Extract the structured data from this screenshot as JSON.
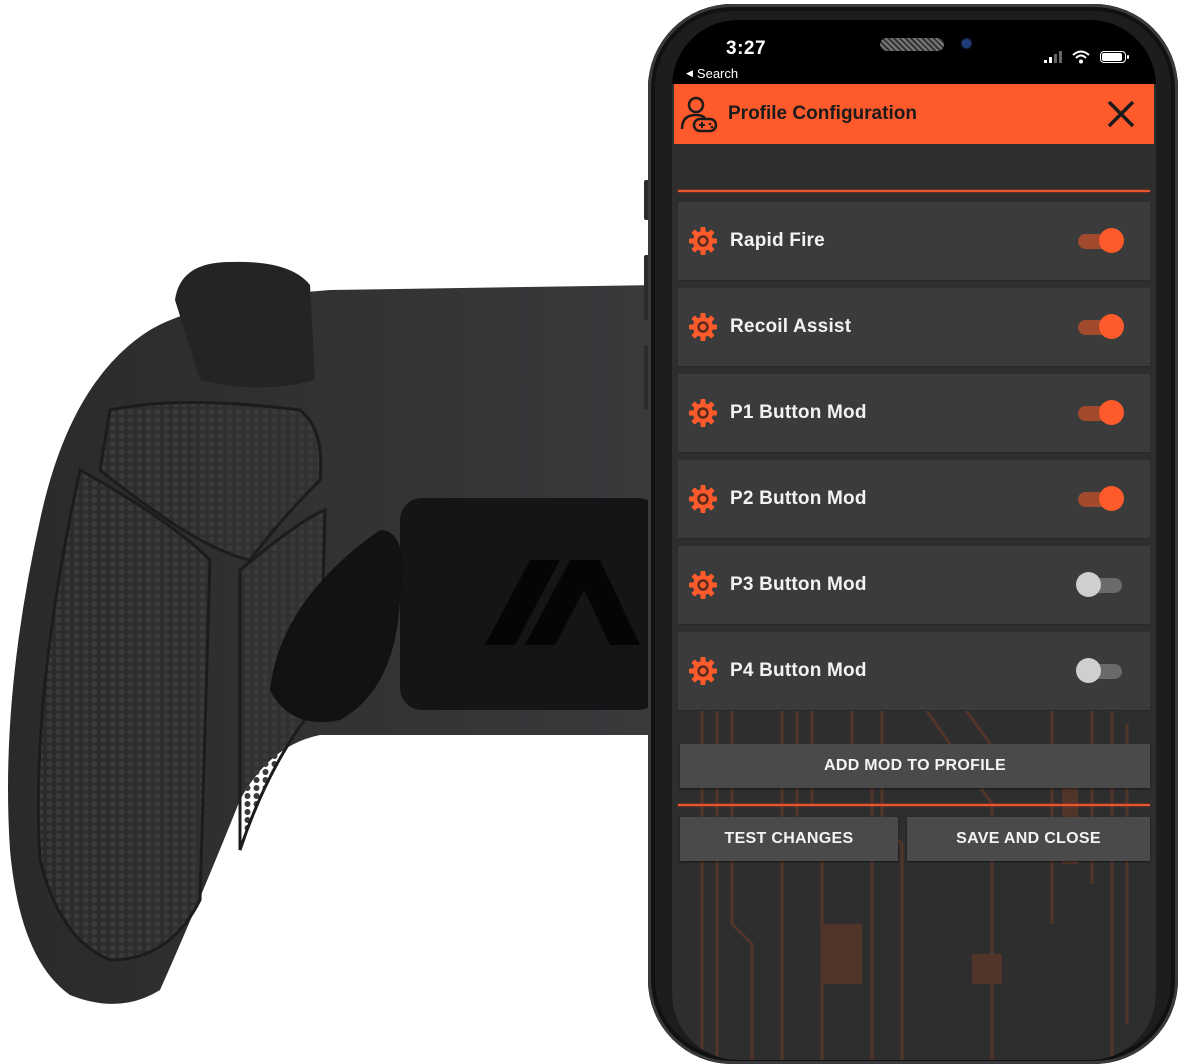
{
  "statusbar": {
    "time": "3:27",
    "back_label": "Search",
    "icons": [
      "cellular-signal-icon",
      "wifi-icon",
      "battery-icon"
    ],
    "battery_level": 0.9
  },
  "header": {
    "icon": "profile-gamepad-icon",
    "title": "Profile Configuration",
    "close_icon": "close-icon"
  },
  "mods": [
    {
      "label": "Rapid Fire",
      "icon": "gear-icon",
      "enabled": true
    },
    {
      "label": "Recoil Assist",
      "icon": "gear-icon",
      "enabled": true
    },
    {
      "label": "P1 Button Mod",
      "icon": "gear-icon",
      "enabled": true
    },
    {
      "label": "P2 Button Mod",
      "icon": "gear-icon",
      "enabled": true
    },
    {
      "label": "P3 Button Mod",
      "icon": "gear-icon",
      "enabled": false
    },
    {
      "label": "P4 Button Mod",
      "icon": "gear-icon",
      "enabled": false
    }
  ],
  "buttons": {
    "add_mod": "ADD MOD TO PROFILE",
    "test_changes": "TEST CHANGES",
    "save_close": "SAVE AND CLOSE"
  },
  "colors": {
    "accent": "#ff5a2b",
    "toggle_on_track": "#a24a2e",
    "toggle_off_knob": "#cfcfcf",
    "row_bg": "#3b3b3b",
    "app_bg": "#2e2e2e"
  }
}
